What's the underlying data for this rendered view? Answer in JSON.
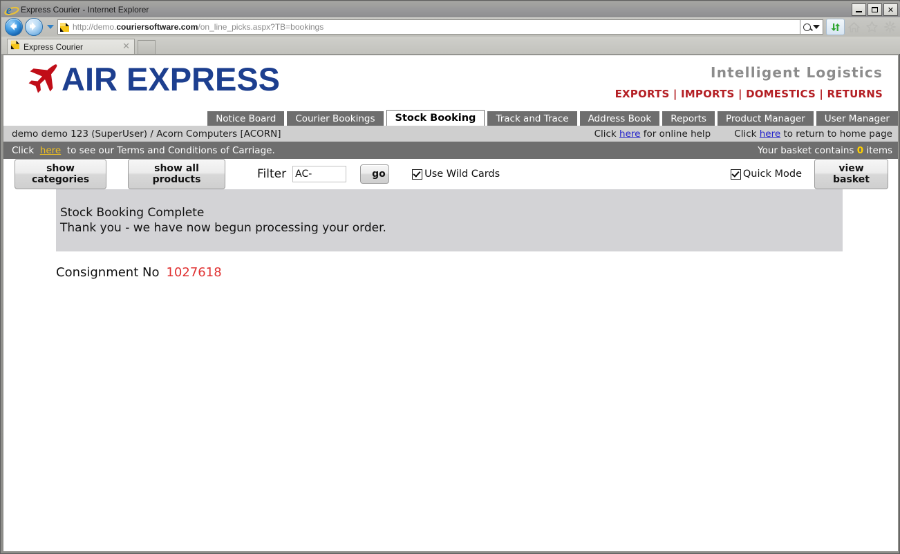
{
  "window": {
    "title": "Express Courier - Internet Explorer",
    "minimize_label": "Minimize",
    "maximize_label": "Maximize",
    "close_label": "✕"
  },
  "browser": {
    "url_prefix": "http://demo.",
    "url_domain": "couriersoftware.com",
    "url_suffix": "/on_line_picks.aspx?TB=bookings",
    "back_label": "Back",
    "forward_label": "Forward",
    "recent_pages_label": "Recent Pages",
    "tab_label": "Express Courier",
    "tab_close_label": "✕",
    "new_tab_label": "New Tab",
    "home_label": "Home",
    "favorites_label": "Favorites",
    "tools_label": "Tools",
    "compat_label": "Compatibility View"
  },
  "site": {
    "brand": "AIR EXPRESS",
    "tagline": "Intelligent Logistics",
    "service_links": "EXPORTS | IMPORTS | DOMESTICS | RETURNS",
    "colors": {
      "brand_blue": "#1d3f8f",
      "plane_red": "#c00d18",
      "service_red": "#b41f24",
      "tagline_gray": "#8c8c8c",
      "tab_gray": "#6e6e6e",
      "panel_gray": "#d3d3d6",
      "consignment_red": "#e03131",
      "link_gold": "#f0c020"
    }
  },
  "nav_tabs": [
    {
      "label": "Notice Board",
      "active": false
    },
    {
      "label": "Courier Bookings",
      "active": false
    },
    {
      "label": "Stock Booking",
      "active": true
    },
    {
      "label": "Track and Trace",
      "active": false
    },
    {
      "label": "Address Book",
      "active": false
    },
    {
      "label": "Reports",
      "active": false
    },
    {
      "label": "Product Manager",
      "active": false
    },
    {
      "label": "User Manager",
      "active": false
    }
  ],
  "info_bar": {
    "user": "demo demo 123 (SuperUser) / Acorn Computers [ACORN]",
    "help_prefix": "Click ",
    "help_link": "here",
    "help_suffix": " for online help",
    "home_prefix": "Click ",
    "home_link": "here",
    "home_suffix": " to return to home page"
  },
  "terms_bar": {
    "prefix": "Click ",
    "link": "here",
    "suffix": " to see our Terms and Conditions of Carriage.",
    "basket_prefix": "Your basket contains ",
    "basket_count": "0",
    "basket_suffix": " items"
  },
  "toolbar": {
    "show_categories": "show categories",
    "show_all_products": "show all products",
    "filter_label": "Filter",
    "filter_value": "AC-",
    "filter_placeholder": "",
    "go": "go",
    "use_wild_cards": "Use Wild Cards",
    "use_wild_cards_checked": true,
    "quick_mode": "Quick Mode",
    "quick_mode_checked": true,
    "view_basket": "view basket"
  },
  "message": {
    "line1": "Stock Booking Complete",
    "line2": "Thank you - we have now begun processing your order."
  },
  "consignment": {
    "label": "Consignment No",
    "number": "1027618"
  }
}
